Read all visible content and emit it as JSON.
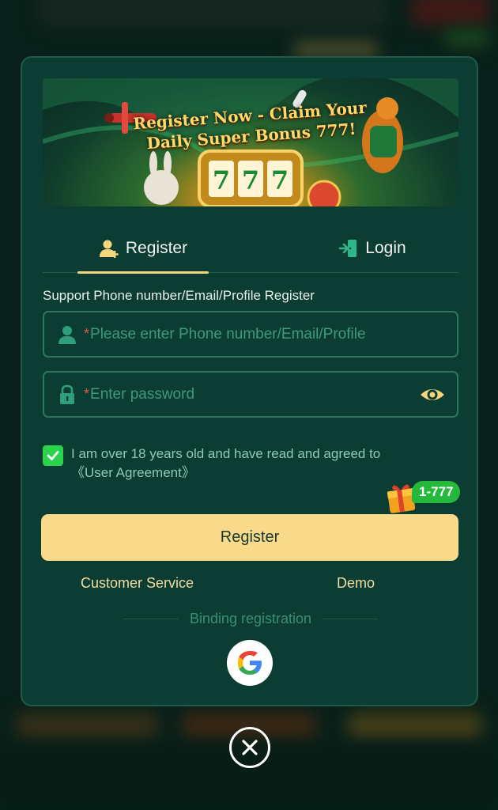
{
  "banner": {
    "headline_line1": "Register Now - Claim Your",
    "headline_line2": "Daily Super Bonus 777!",
    "reel": [
      "7",
      "7",
      "7"
    ]
  },
  "tabs": [
    {
      "label": "Register",
      "icon": "user-plus-icon",
      "active": true
    },
    {
      "label": "Login",
      "icon": "door-enter-icon",
      "active": false
    }
  ],
  "form": {
    "support_label": "Support Phone number/Email/Profile Register",
    "required_mark": "*",
    "username_placeholder": "Please enter Phone number/Email/Profile",
    "password_placeholder": "Enter password",
    "agree_text": "I am over 18 years old and have read and agreed to",
    "agreement_link": "《User Agreement》",
    "agree_checked": true
  },
  "bonus_badge": "1-777",
  "register_button": "Register",
  "links": {
    "customer_service": "Customer Service",
    "demo": "Demo"
  },
  "binding_label": "Binding registration",
  "colors": {
    "modal_bg": "#0b3d32",
    "accent_gold": "#f9d98a",
    "field_border": "#2f7560",
    "placeholder": "#3f9a7a",
    "checkbox": "#2bd24b",
    "badge": "#24b83d",
    "link": "#f2dda2"
  }
}
